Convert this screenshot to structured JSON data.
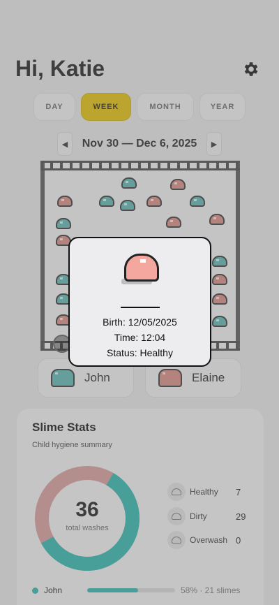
{
  "header": {
    "greeting": "Hi, Katie"
  },
  "tabs": [
    {
      "label": "DAY",
      "active": false
    },
    {
      "label": "WEEK",
      "active": true
    },
    {
      "label": "MONTH",
      "active": false
    },
    {
      "label": "YEAR",
      "active": false
    }
  ],
  "date_range": {
    "label": "Nov 30 — Dec 6, 2025",
    "prev_icon": "◀",
    "next_icon": "▶"
  },
  "kids": [
    {
      "name": "John",
      "color": "#5ab5b0"
    },
    {
      "name": "Elaine",
      "color": "#d98980"
    }
  ],
  "stats": {
    "title": "Slime Stats",
    "subtitle": "Child hygiene summary",
    "total": "36",
    "total_label": "total washes",
    "legend": [
      {
        "label": "Healthy",
        "value": "7"
      },
      {
        "label": "Dirty",
        "value": "29"
      },
      {
        "label": "Overwash",
        "value": "0"
      }
    ],
    "kid_row": {
      "name": "John",
      "pct_text": "58% · 21 slimes",
      "fraction": 0.58
    },
    "accent_teal": "#2ab6ad",
    "accent_pink": "#d99a99"
  },
  "popup": {
    "birth": "Birth: 12/05/2025",
    "time": "Time: 12:04",
    "status": "Status: Healthy"
  }
}
